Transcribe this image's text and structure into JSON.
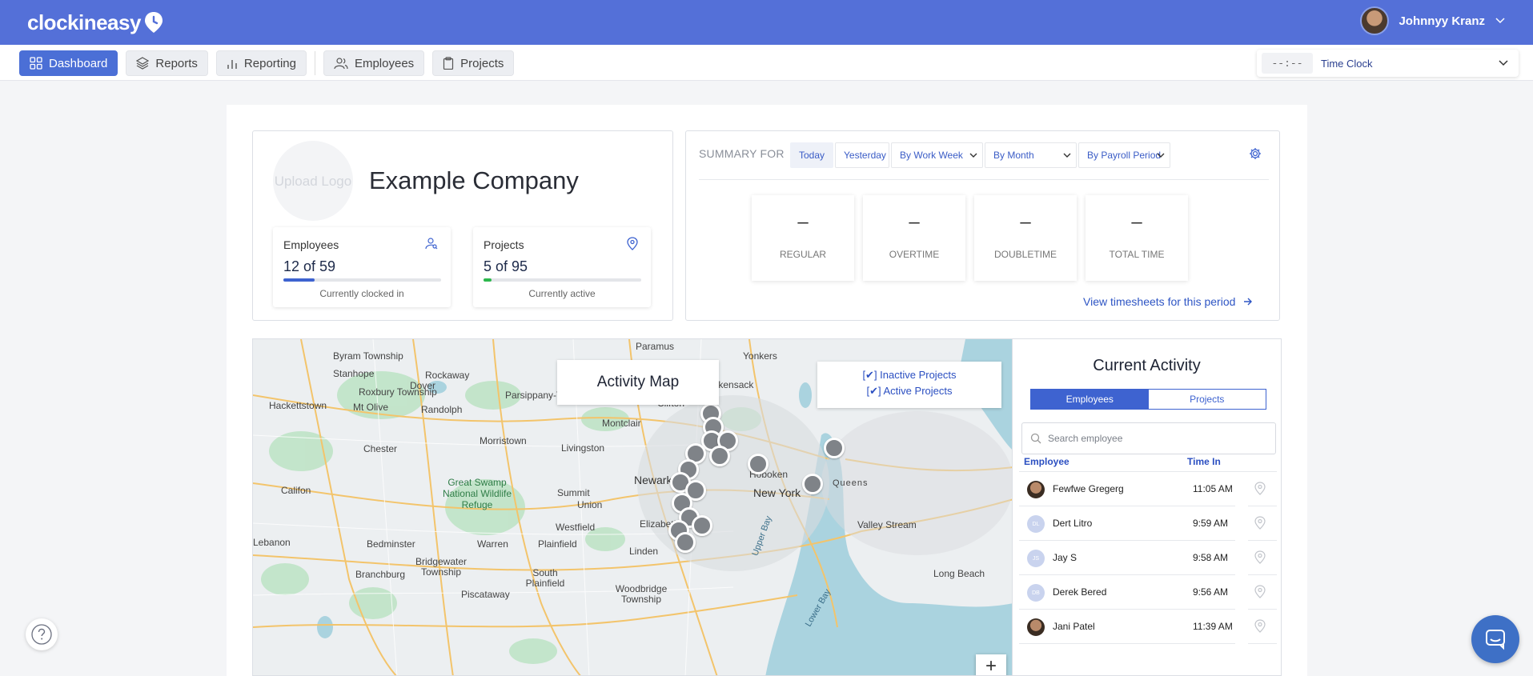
{
  "brand": {
    "name": "clockineasy"
  },
  "user": {
    "name": "Johnnyy Kranz"
  },
  "nav": {
    "items": [
      {
        "label": "Dashboard",
        "icon": "grid-icon",
        "active": true
      },
      {
        "label": "Reports",
        "icon": "layers-icon"
      },
      {
        "label": "Reporting",
        "icon": "bar-chart-icon"
      },
      {
        "label": "Employees",
        "icon": "users-icon"
      },
      {
        "label": "Projects",
        "icon": "clipboard-icon"
      }
    ]
  },
  "timeclock": {
    "time": "--:--",
    "label": "Time Clock"
  },
  "company": {
    "upload_logo": "Upload Logo",
    "name": "Example Company",
    "employees": {
      "label": "Employees",
      "value": "12 of 59",
      "fraction": 0.2,
      "sub": "Currently clocked in",
      "bar_color": "#3e63d0"
    },
    "projects": {
      "label": "Projects",
      "value": "5 of 95",
      "fraction": 0.05,
      "sub": "Currently active",
      "bar_color": "#2db84d"
    }
  },
  "summary": {
    "title": "SUMMARY FOR",
    "filters": [
      "Today",
      "Yesterday",
      "By Work Week",
      "By Month",
      "By Payroll Period"
    ],
    "metrics": [
      {
        "value": "–",
        "label": "REGULAR"
      },
      {
        "value": "–",
        "label": "OVERTIME"
      },
      {
        "value": "–",
        "label": "DOUBLETIME"
      },
      {
        "value": "–",
        "label": "TOTAL TIME"
      }
    ],
    "link": "View timesheets for this period"
  },
  "map": {
    "title": "Activity Map",
    "filters": [
      "[✔] Inactive Projects",
      "[✔] Active Projects"
    ],
    "zoom_in": "+",
    "places": [
      "Paramus",
      "Yonkers",
      "Byram Township",
      "Stanhope",
      "Rockaway",
      "Dover",
      "Roxbury Township",
      "Parsippany-Troy Hills",
      "Hackettstown",
      "Mt Olive",
      "Randolph",
      "Hackensack",
      "Clifton",
      "Montclair",
      "Morristown",
      "Chester",
      "Livingston",
      "Newark",
      "Hoboken",
      "New York",
      "Califon",
      "Summit",
      "Union",
      "Elizabeth",
      "Westfield",
      "Bedminster",
      "Warren",
      "Plainfield",
      "Linden",
      "Lebanon",
      "Branchburg",
      "Bridgewater Township",
      "South Plainfield",
      "Woodbridge Township",
      "Piscataway",
      "Valley Stream",
      "Long Beach",
      "Queens",
      "Upper Bay",
      "Lower Bay",
      "Great Swamp National Wildlife Refuge"
    ]
  },
  "activity": {
    "title": "Current Activity",
    "tabs": [
      "Employees",
      "Projects"
    ],
    "search_placeholder": "Search employee",
    "headers": [
      "Employee",
      "Time In"
    ],
    "rows": [
      {
        "initials": "",
        "name": "Fewfwe Gregerg",
        "time": "11:05 AM"
      },
      {
        "initials": "DL",
        "name": "Dert Litro",
        "time": "9:59 AM"
      },
      {
        "initials": "JS",
        "name": "Jay S",
        "time": "9:58 AM"
      },
      {
        "initials": "DB",
        "name": "Derek Bered",
        "time": "9:56 AM"
      },
      {
        "initials": "",
        "name": "Jani Patel",
        "time": "11:39 AM"
      }
    ]
  },
  "colors": {
    "topbar": "#5470d8",
    "accent": "#3e63d0",
    "link": "#2e55c4"
  }
}
